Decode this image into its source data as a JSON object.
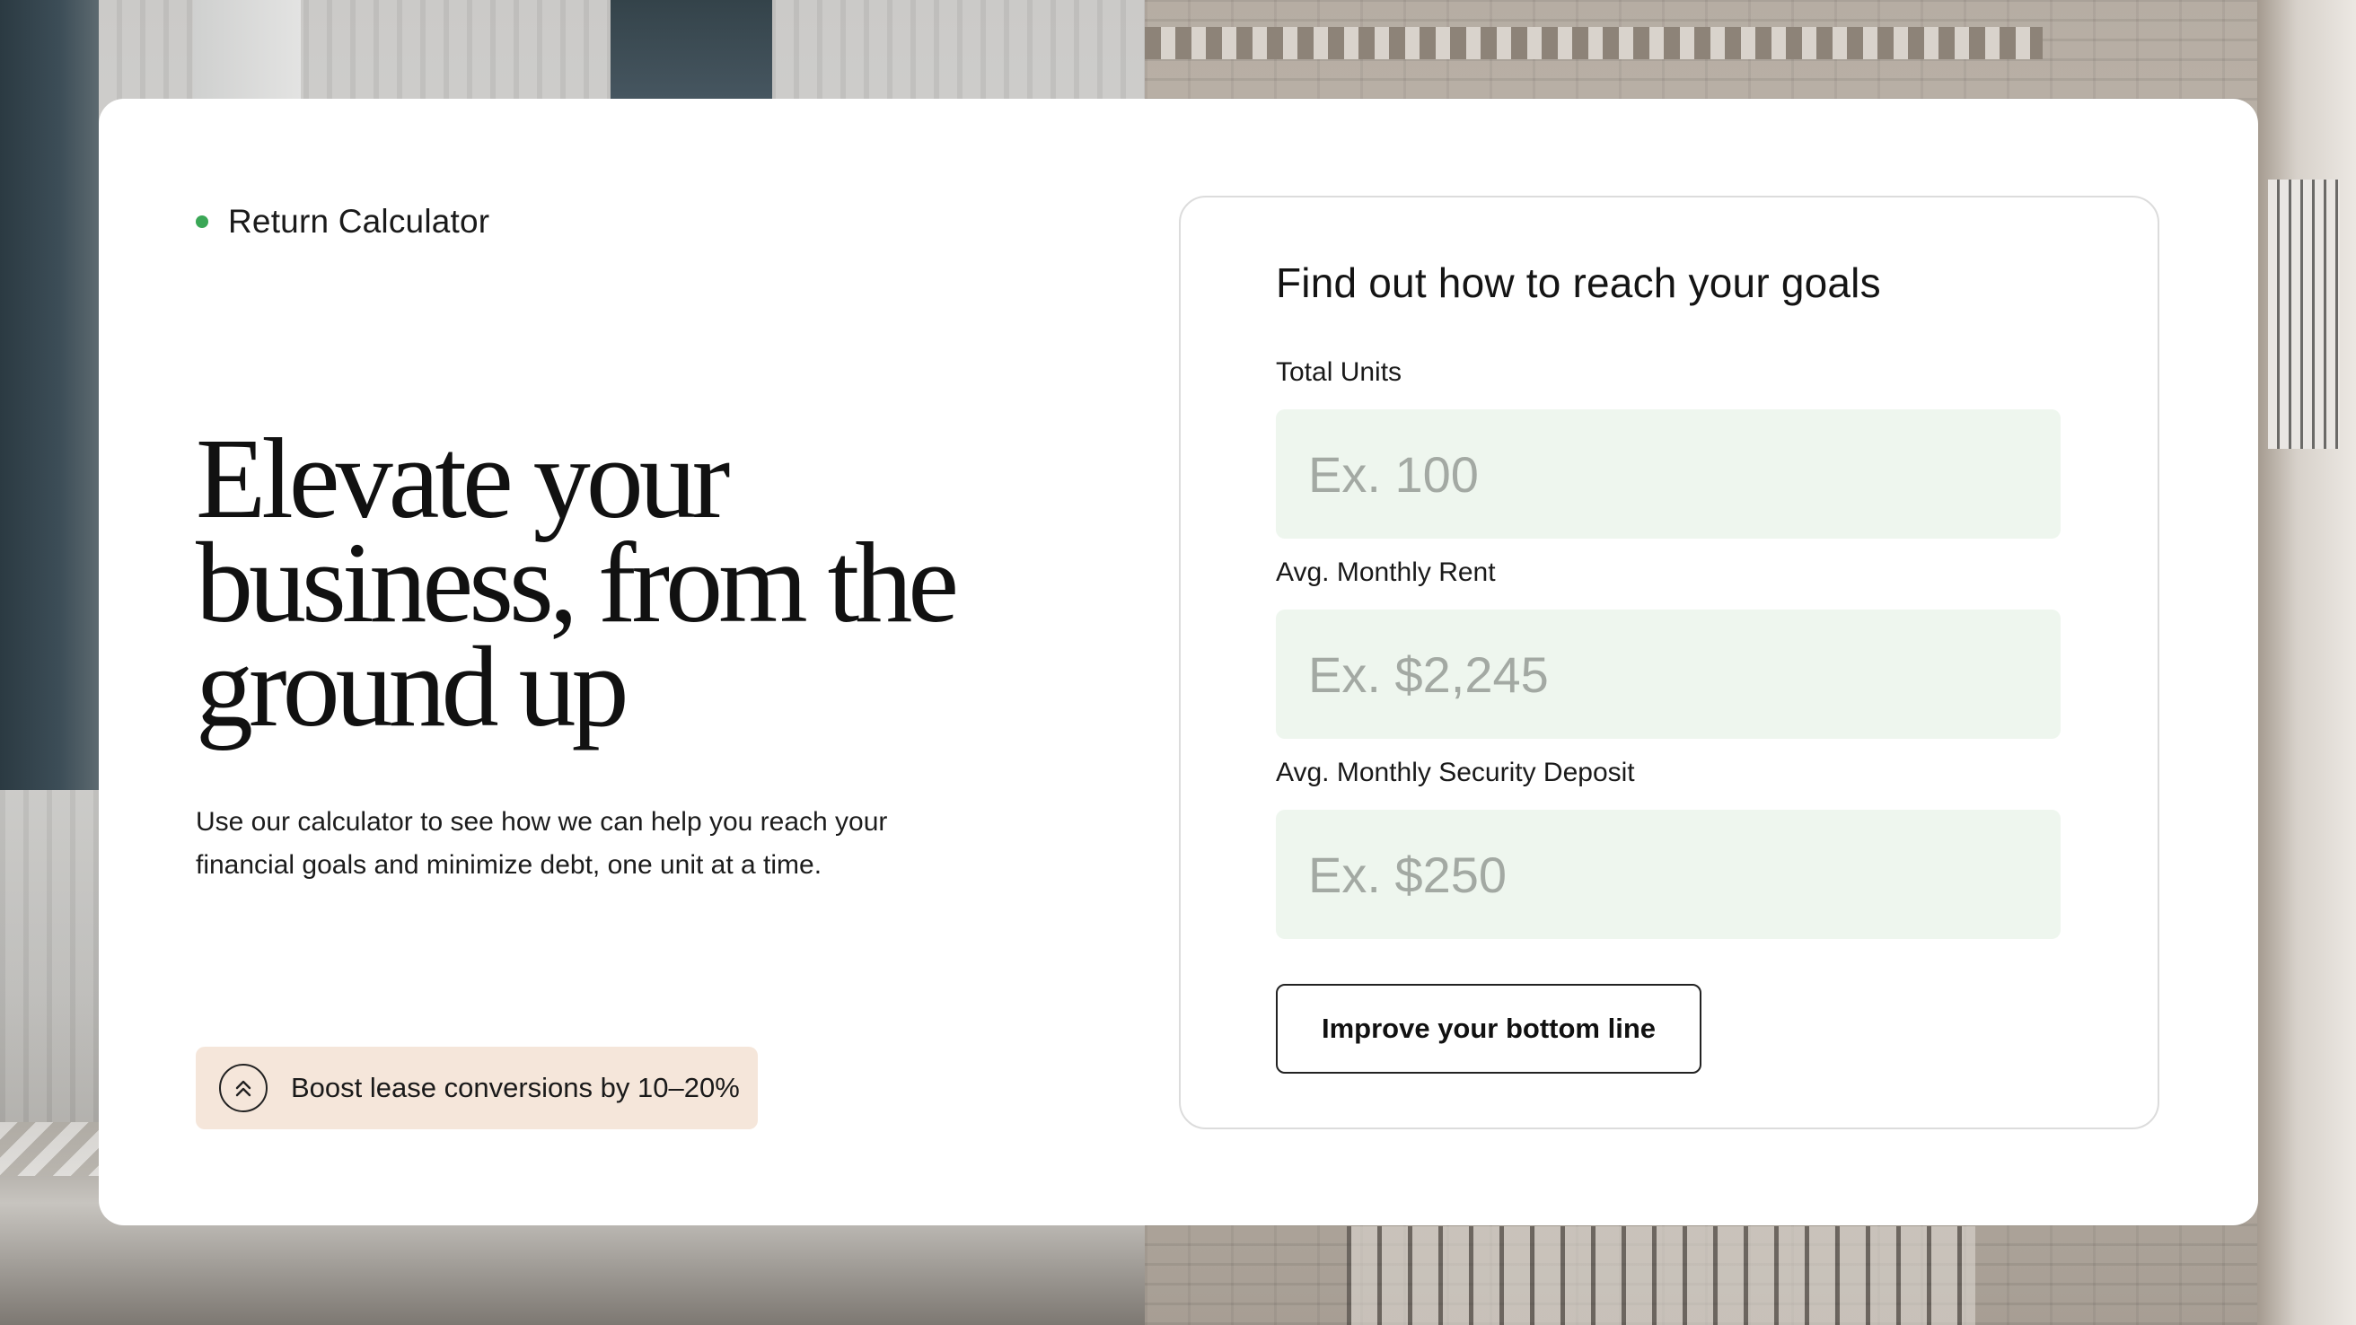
{
  "intro": {
    "eyebrow": "Return Calculator",
    "title": "Elevate your business, from the ground up",
    "description": "Use our calculator to see how we can help you reach your financial goals and minimize debt, one unit at a time.",
    "badge": {
      "icon": "double-chevron-up-icon",
      "label": "Boost lease conversions by 10–20%"
    }
  },
  "calculator": {
    "title": "Find out how to reach your goals",
    "fields": [
      {
        "label": "Total Units",
        "placeholder": "Ex. 100"
      },
      {
        "label": "Avg. Monthly Rent",
        "placeholder": "Ex. $2,245"
      },
      {
        "label": "Avg. Monthly Security Deposit",
        "placeholder": "Ex. $250"
      }
    ],
    "cta_label": "Improve your bottom line"
  },
  "colors": {
    "accent_dot": "#3aa756",
    "input_bg": "#eef6ee",
    "badge_bg": "#f5e6da",
    "card_bg": "#ffffff"
  }
}
